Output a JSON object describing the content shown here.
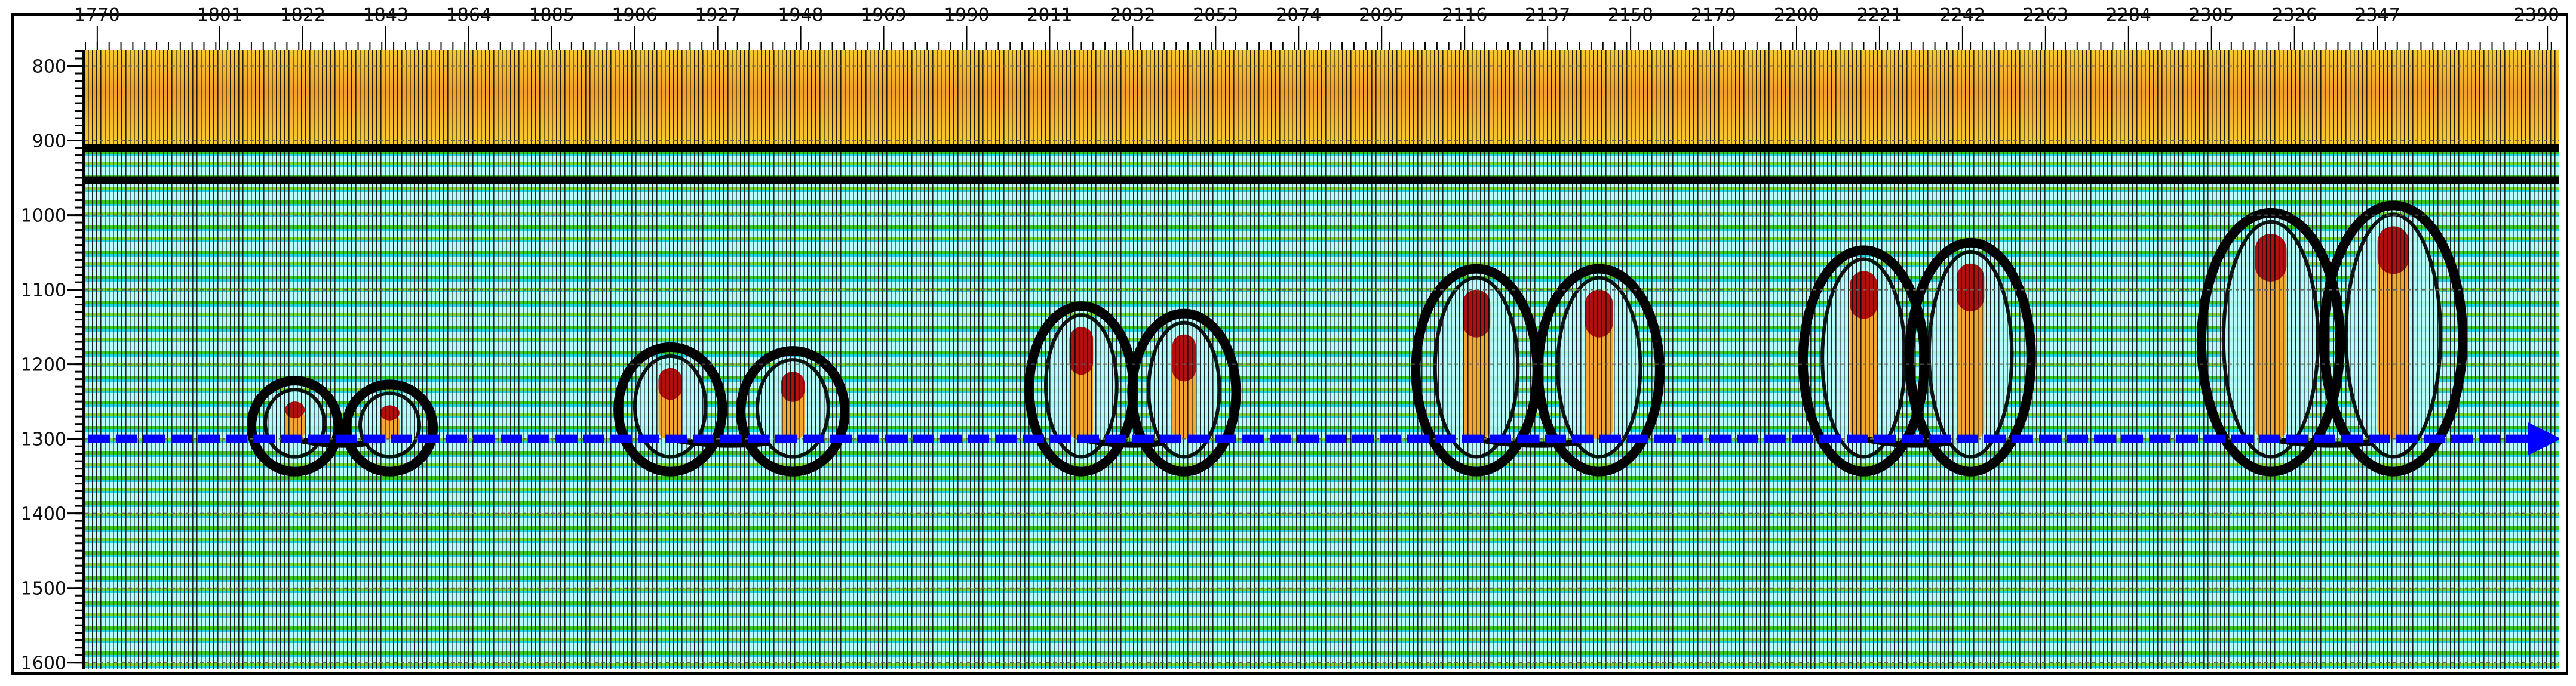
{
  "chart_data": {
    "type": "heatmap",
    "subtype": "seismic-wiggle-variable-density",
    "title": "",
    "xlabel": "",
    "ylabel": "",
    "xlim": [
      1767,
      2393
    ],
    "ylim": [
      1609,
      778
    ],
    "x_ticks": [
      1770,
      1801,
      1822,
      1843,
      1864,
      1885,
      1906,
      1927,
      1948,
      1969,
      1990,
      2011,
      2032,
      2053,
      2074,
      2095,
      2116,
      2137,
      2158,
      2179,
      2200,
      2221,
      2242,
      2263,
      2284,
      2305,
      2326,
      2347,
      2390
    ],
    "y_ticks": [
      800,
      900,
      1000,
      1100,
      1200,
      1300,
      1400,
      1500,
      1600
    ],
    "x_axis_position": "top",
    "grid": "dashed-horizontal",
    "layers": [
      {
        "name": "upper high-amplitude zone",
        "from": 778,
        "to": 905,
        "color": "#f5c02a"
      },
      {
        "name": "strong reflector",
        "from": 905,
        "to": 915,
        "color": "#000000"
      },
      {
        "name": "second reflector",
        "from": 948,
        "to": 958,
        "color": "#000000"
      },
      {
        "name": "background",
        "from": 915,
        "to": 1609,
        "color": "#7fe8f0"
      }
    ],
    "bright_spots": [
      {
        "trace": 1820,
        "top": 1250,
        "bottom": 1300,
        "width": 5
      },
      {
        "trace": 1844,
        "top": 1255,
        "bottom": 1300,
        "width": 5
      },
      {
        "trace": 1915,
        "top": 1205,
        "bottom": 1300,
        "width": 6
      },
      {
        "trace": 1946,
        "top": 1210,
        "bottom": 1300,
        "width": 6
      },
      {
        "trace": 2019,
        "top": 1150,
        "bottom": 1300,
        "width": 6
      },
      {
        "trace": 2045,
        "top": 1160,
        "bottom": 1300,
        "width": 6
      },
      {
        "trace": 2119,
        "top": 1100,
        "bottom": 1300,
        "width": 7
      },
      {
        "trace": 2150,
        "top": 1100,
        "bottom": 1300,
        "width": 7
      },
      {
        "trace": 2217,
        "top": 1075,
        "bottom": 1300,
        "width": 7
      },
      {
        "trace": 2244,
        "top": 1065,
        "bottom": 1300,
        "width": 7
      },
      {
        "trace": 2320,
        "top": 1025,
        "bottom": 1300,
        "width": 8
      },
      {
        "trace": 2351,
        "top": 1015,
        "bottom": 1300,
        "width": 8
      }
    ],
    "horizon_marker": {
      "time": 1300,
      "style": "dashed-arrow",
      "color": "#0000ff"
    },
    "colors": {
      "peak_top": "#b01010",
      "peak_body": "#f2a830",
      "trough": "#000000",
      "bg_light": "#b8fbff",
      "bg_green": "#3ec81e",
      "bg_cyan": "#18d8e8"
    }
  }
}
